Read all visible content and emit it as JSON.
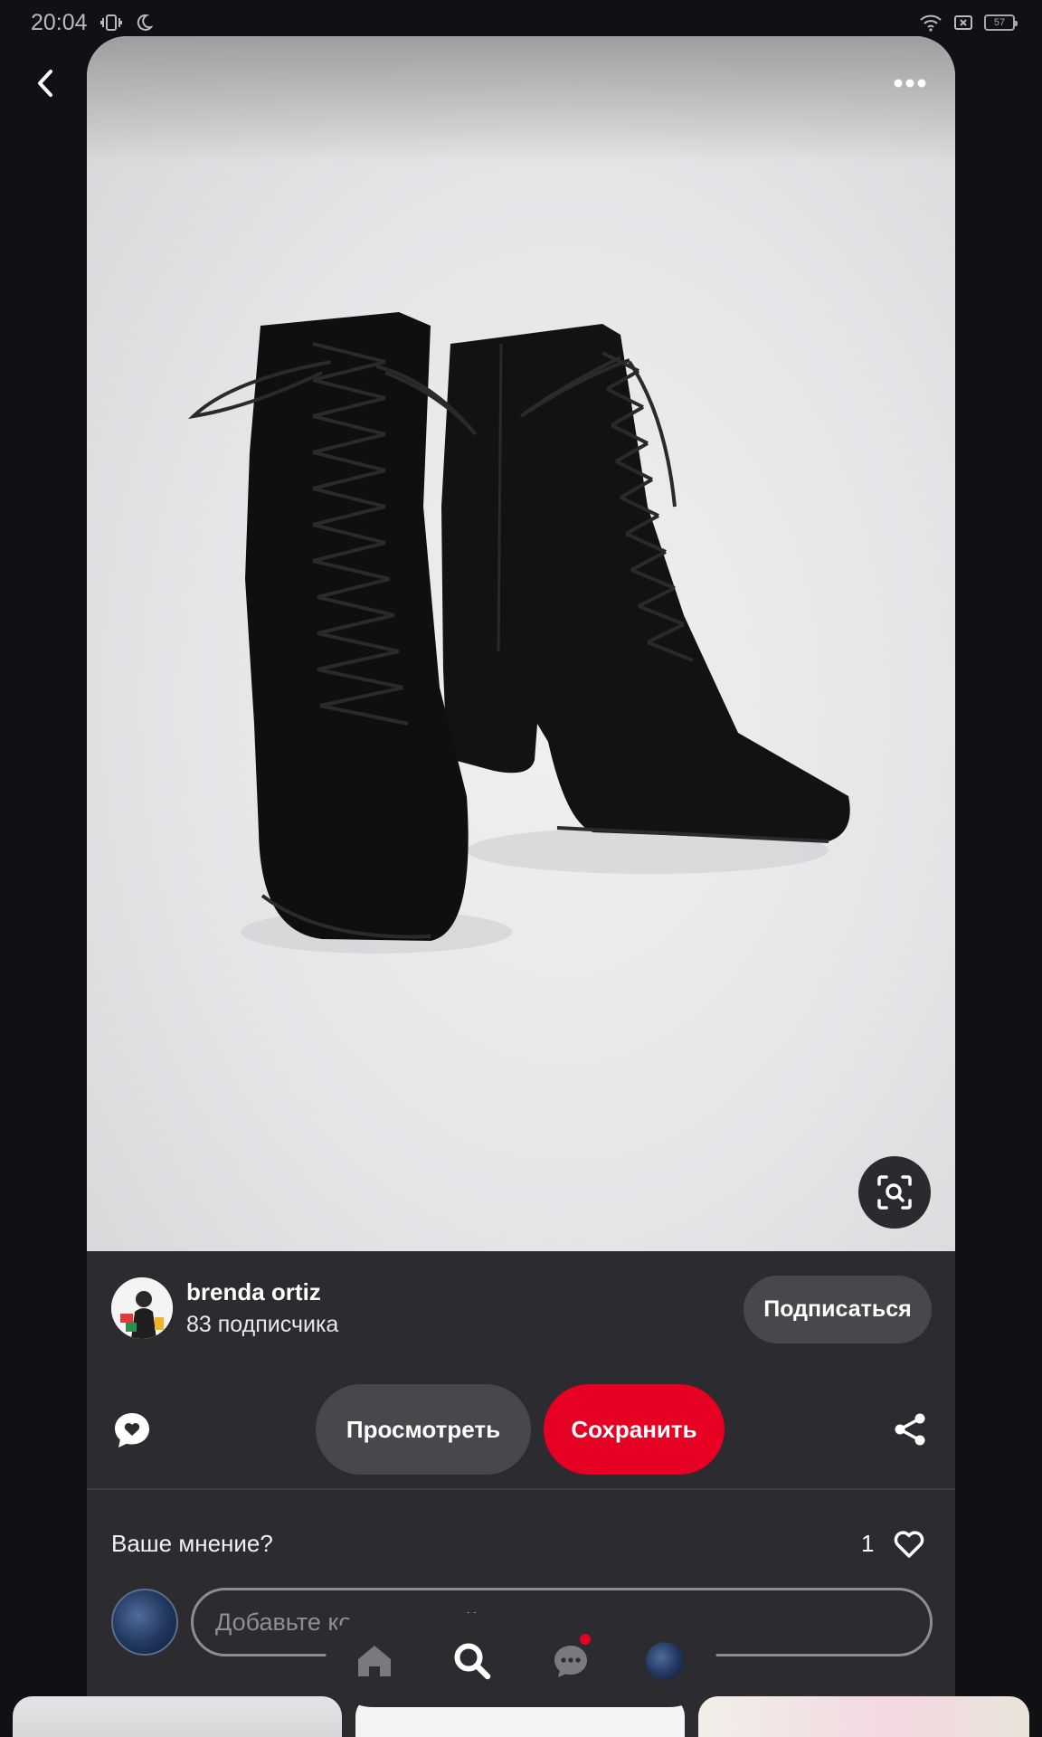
{
  "status_bar": {
    "time": "20:04",
    "battery": "57"
  },
  "pin": {
    "image_alt": "Black suede lace-up heeled ankle boots"
  },
  "creator": {
    "name": "brenda ortiz",
    "followers": "83 подписчика",
    "follow_label": "Подписаться"
  },
  "actions": {
    "view_label": "Просмотреть",
    "save_label": "Сохранить"
  },
  "comments": {
    "prompt": "Ваше мнение?",
    "like_count": "1",
    "input_placeholder": "Добавьте комментарий"
  },
  "colors": {
    "background": "#111014",
    "card": "#2c2b2f",
    "button_secondary": "#48474b",
    "accent_red": "#e60023"
  },
  "icons": {
    "back": "chevron-left-icon",
    "more": "more-horizontal-icon",
    "visual_search": "visual-search-icon",
    "comment": "comment-heart-icon",
    "share": "share-icon",
    "like": "heart-outline-icon",
    "nav_home": "home-icon",
    "nav_search": "search-icon",
    "nav_messages": "chat-icon"
  }
}
